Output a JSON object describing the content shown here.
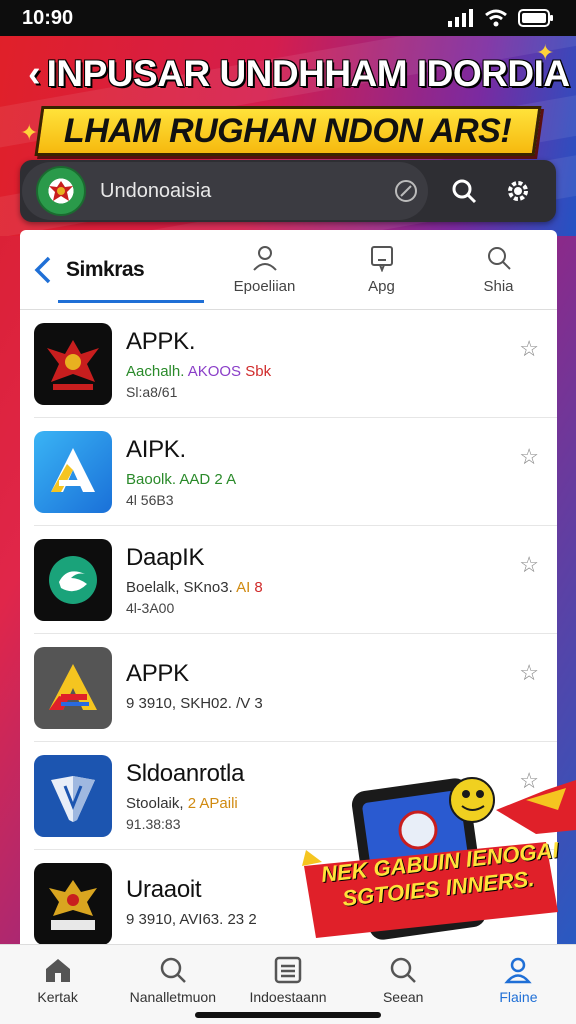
{
  "status": {
    "time": "10:90"
  },
  "banner": {
    "title": "INPUSAR UNDHHAM IDORDIA",
    "subtitle": "LHAM RUGHAN NDON ARS!"
  },
  "search": {
    "text": "Undonoaisia"
  },
  "tabs": {
    "main": "Simkras",
    "items": [
      {
        "label": "Epoeliian",
        "icon": "user-icon"
      },
      {
        "label": "Apg",
        "icon": "message-icon"
      },
      {
        "label": "Shia",
        "icon": "search-icon"
      }
    ]
  },
  "apps": [
    {
      "name": "APPK.",
      "sub": [
        {
          "t": "Aachalh.",
          "c": "g"
        },
        {
          "t": " AKOOS",
          "c": "p"
        },
        {
          "t": " Sbk",
          "c": "r"
        }
      ],
      "meta": "Sl:a8/61",
      "icon": "garuda-emblem-icon",
      "bg": "#0d0d0d"
    },
    {
      "name": "AIPK.",
      "sub": [
        {
          "t": "Baoolk. AAD 2 A",
          "c": "g"
        }
      ],
      "meta": "4l 56B3",
      "icon": "app-store-a-icon",
      "bg": "#2a8fe0"
    },
    {
      "name": "DaapIK",
      "sub": [
        {
          "t": "Boelalk, SKno3.",
          "c": "d"
        },
        {
          "t": "  AI",
          "c": "o"
        },
        {
          "t": " 8",
          "c": "r"
        }
      ],
      "meta": "4l-3A00",
      "icon": "swirl-logo-icon",
      "bg": "#0d0d0d"
    },
    {
      "name": "APPK",
      "sub": [
        {
          "t": "9  3910, SKH02.  /V  3",
          "c": "d"
        }
      ],
      "meta": "",
      "icon": "letter-a-icon",
      "bg": "#555555"
    },
    {
      "name": "Sldoanrotla",
      "sub": [
        {
          "t": "Stoolaik, ",
          "c": "d"
        },
        {
          "t": "2 APaili",
          "c": "o"
        }
      ],
      "meta": "91.38:83",
      "icon": "shield-arrow-icon",
      "bg": "#1c55b0"
    },
    {
      "name": "Uraaoit",
      "sub": [
        {
          "t": "9  3910, AVI63.  23  2",
          "c": "d"
        }
      ],
      "meta": "",
      "icon": "garuda-emblem-icon",
      "bg": "#0d0d0d"
    }
  ],
  "promo": {
    "line1": "NEK GABUIN IENOGAI",
    "line2": "SGTOIES INNERS."
  },
  "nav": [
    {
      "label": "Kertak",
      "icon": "home-icon"
    },
    {
      "label": "Nanalletmuon",
      "icon": "search-icon"
    },
    {
      "label": "Indoestaann",
      "icon": "list-icon"
    },
    {
      "label": "Seean",
      "icon": "search-icon"
    },
    {
      "label": "Flaine",
      "icon": "profile-icon",
      "active": true
    }
  ],
  "colors": {
    "accent": "#1f6fd6",
    "banner_red": "#e02029",
    "subbanner_yellow": "#ffe23a"
  }
}
